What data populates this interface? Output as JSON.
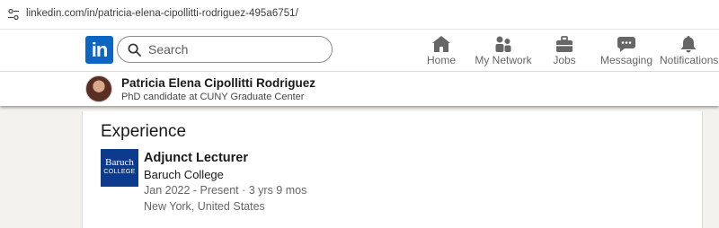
{
  "browser": {
    "url": "linkedin.com/in/patricia-elena-cipollitti-rodriguez-495a6751/",
    "icon": "site-info-icon"
  },
  "nav": {
    "logo_text": "in",
    "search_placeholder": "Search",
    "items": [
      {
        "label": "Home",
        "icon": "home-icon"
      },
      {
        "label": "My Network",
        "icon": "network-icon"
      },
      {
        "label": "Jobs",
        "icon": "briefcase-icon"
      },
      {
        "label": "Messaging",
        "icon": "messaging-icon"
      },
      {
        "label": "Notifications",
        "icon": "bell-icon"
      }
    ]
  },
  "profile": {
    "name": "Patricia Elena Cipollitti Rodriguez",
    "headline": "PhD candidate at CUNY Graduate Center"
  },
  "experience": {
    "title": "Experience",
    "items": [
      {
        "role": "Adjunct Lecturer",
        "company": "Baruch College",
        "logo_line1": "Baruch",
        "logo_line2": "COLLEGE",
        "dates": "Jan 2022 - Present · 3 yrs 9 mos",
        "location": "New York, United States"
      }
    ]
  },
  "colors": {
    "brand": "#0a66c2",
    "baruch": "#0c3a8c",
    "page_bg": "#f4f2ee"
  }
}
